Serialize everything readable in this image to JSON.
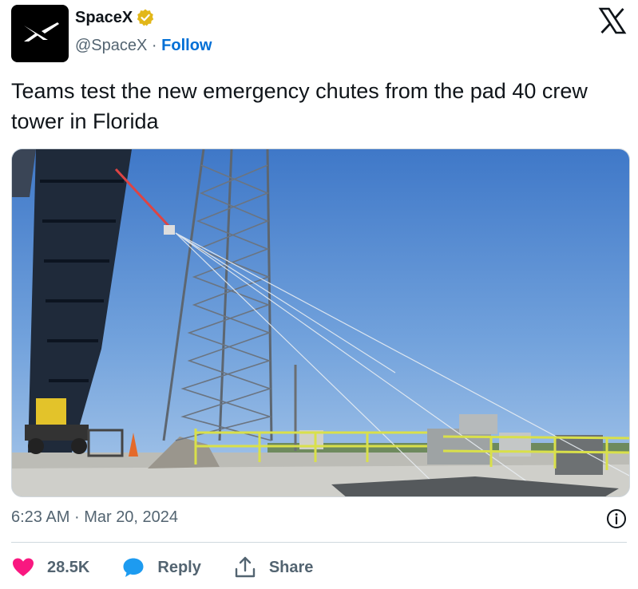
{
  "account": {
    "display_name": "SpaceX",
    "handle": "@SpaceX",
    "separator": "·",
    "follow_label": "Follow"
  },
  "tweet": {
    "text": "Teams test the new emergency chutes from the pad 40 crew tower in Florida"
  },
  "meta": {
    "time": "6:23 AM",
    "separator": "·",
    "date": "Mar 20, 2024"
  },
  "actions": {
    "like_count": "28.5K",
    "reply_label": "Reply",
    "share_label": "Share"
  },
  "colors": {
    "like": "#f91880",
    "reply": "#1d9bf0",
    "link": "#006fd6",
    "verified": "#e2b719"
  },
  "icons": {
    "avatar": "spacex-logo",
    "verified": "verified-badge-icon",
    "brand": "x-logo-icon",
    "info": "info-icon",
    "like": "heart-icon",
    "reply": "speech-bubble-icon",
    "share": "share-upload-icon"
  }
}
